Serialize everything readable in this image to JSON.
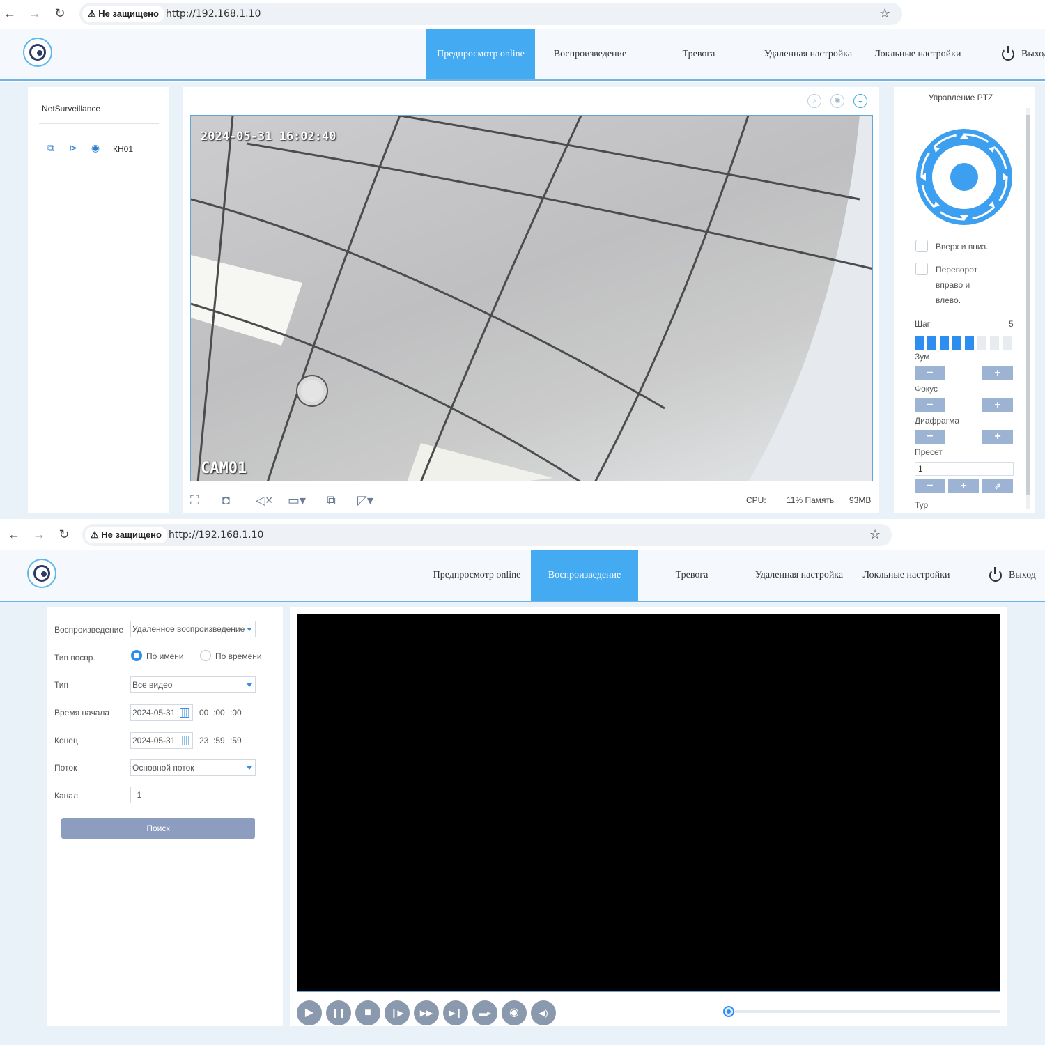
{
  "screen1": {
    "browser": {
      "nav_back": "←",
      "nav_forward": "→",
      "nav_reload": "↻",
      "security": "⚠ Не защищено",
      "url": "http://192.168.1.10",
      "star": "☆"
    },
    "header": {
      "tabs": [
        {
          "label": "Предпросмотр online",
          "active": true
        },
        {
          "label": "Воспроизведение",
          "active": false
        },
        {
          "label": "Тревога",
          "active": false
        },
        {
          "label": "Удаленная настройка",
          "active": false
        },
        {
          "label": "Локльные настройки",
          "active": false
        }
      ],
      "exit_label": "Выход"
    },
    "device_tree": {
      "title": "NetSurveillance",
      "channel_label": "КН01"
    },
    "video": {
      "toolbar_icons": [
        "microphone-icon",
        "brightness-icon",
        "camera-dome-icon"
      ],
      "osd_time": "2024-05-31 16:02:40",
      "osd_name": "CAM01"
    },
    "bottom_toolbar_icons": [
      "fullscreen-icon",
      "snapshot-icon",
      "mute-icon",
      "display-mode-icon",
      "record-icon",
      "aspect-ratio-icon"
    ],
    "stats": {
      "cpu_label": "CPU:",
      "cpu_and_mem": "11% Память",
      "mem_value": "93MB"
    },
    "ptz": {
      "title": "Управление PTZ",
      "flip_vertical": "Вверх и вниз.",
      "flip_horizontal": [
        "Переворот",
        "вправо и",
        "влево."
      ],
      "step_label": "Шаг",
      "step_value": "5",
      "step_level": 5,
      "step_max": 8,
      "zoom_label": "Зум",
      "focus_label": "Фокус",
      "iris_label": "Диафрагма",
      "preset_label": "Пресет",
      "preset_value": "1",
      "tour_label": "Тур",
      "minus": "−",
      "plus": "+",
      "goto": "⇗"
    },
    "colors": {
      "accent": "#44aaf2",
      "ptz_blue": "#2e8ef0",
      "button": "#9cb3d4"
    }
  },
  "screen2": {
    "browser": {
      "nav_back": "←",
      "nav_forward": "→",
      "nav_reload": "↻",
      "security": "⚠ Не защищено",
      "url": "http://192.168.1.10",
      "star": "☆"
    },
    "header": {
      "tabs": [
        {
          "label": "Предпросмотр online",
          "active": false
        },
        {
          "label": "Воспроизведение",
          "active": true
        },
        {
          "label": "Тревога",
          "active": false
        },
        {
          "label": "Удаленная настройка",
          "active": false
        },
        {
          "label": "Локльные настройки",
          "active": false
        }
      ],
      "exit_label": "Выход"
    },
    "search": {
      "playback_label": "Воспроизведение",
      "playback_value": "Удаленное воспроизведение",
      "mode_label": "Тип воспр.",
      "mode_by_name": "По имени",
      "mode_by_time": "По времени",
      "mode_selected": "По имени",
      "type_label": "Тип",
      "type_value": "Все видео",
      "start_label": "Время начала",
      "start_date": "2024-05-31",
      "start_h": "00",
      "start_m": ":00",
      "start_s": ":00",
      "end_label": "Конец",
      "end_date": "2024-05-31",
      "end_h": "23",
      "end_m": ":59",
      "end_s": ":59",
      "stream_label": "Поток",
      "stream_value": "Основной поток",
      "channel_label": "Канал",
      "channel_value": "1",
      "search_button": "Поиск"
    },
    "controls": {
      "buttons": [
        {
          "name": "play-icon",
          "glyph": "▶"
        },
        {
          "name": "pause-icon",
          "glyph": "❚❚"
        },
        {
          "name": "stop-icon",
          "glyph": "■"
        },
        {
          "name": "slow-icon",
          "glyph": "❙▶"
        },
        {
          "name": "fast-forward-icon",
          "glyph": "▶▶"
        },
        {
          "name": "next-frame-icon",
          "glyph": "▶❙"
        },
        {
          "name": "record-icon",
          "glyph": "▬▸"
        },
        {
          "name": "snapshot-icon",
          "glyph": "◉"
        },
        {
          "name": "volume-icon",
          "glyph": "◀)"
        }
      ],
      "progress": 0
    }
  }
}
